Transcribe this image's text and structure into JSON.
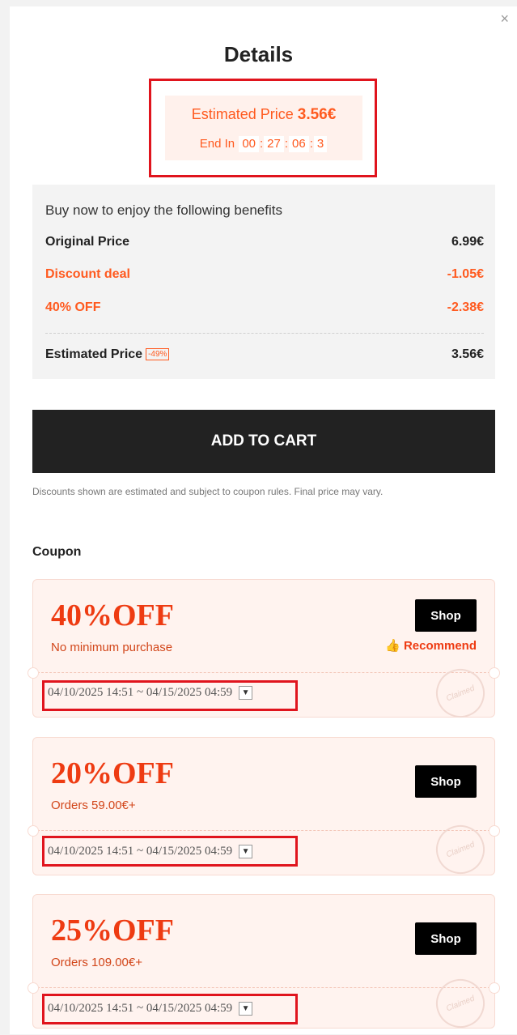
{
  "header": {
    "title": "Details",
    "close_glyph": "×"
  },
  "estimate": {
    "label": "Estimated Price",
    "price": "3.56€",
    "end_label": "End In",
    "timer": [
      "00",
      "27",
      "06",
      "3"
    ],
    "separator": ":"
  },
  "benefits": {
    "heading": "Buy now to enjoy the following benefits",
    "rows": [
      {
        "label": "Original Price",
        "value": "6.99€"
      },
      {
        "label": "Discount deal",
        "value": "-1.05€"
      },
      {
        "label": "40% OFF",
        "value": "-2.38€"
      }
    ],
    "total": {
      "label": "Estimated Price",
      "badge": "-49%",
      "value": "3.56€"
    }
  },
  "cart_button": "ADD TO CART",
  "disclaimer": "Discounts shown are estimated and subject to coupon rules. Final price may vary.",
  "coupon_heading": "Coupon",
  "coupons": [
    {
      "amount": "40%OFF",
      "condition": "No minimum purchase",
      "shop": "Shop",
      "recommend": "Recommend",
      "date": "04/10/2025 14:51 ~ 04/15/2025 04:59",
      "stamp": "Claimed"
    },
    {
      "amount": "20%OFF",
      "condition": "Orders 59.00€+",
      "shop": "Shop",
      "date": "04/10/2025 14:51 ~ 04/15/2025 04:59",
      "stamp": "Claimed"
    },
    {
      "amount": "25%OFF",
      "condition": "Orders 109.00€+",
      "shop": "Shop",
      "date": "04/10/2025 14:51 ~ 04/15/2025 04:59",
      "stamp": "Claimed"
    }
  ],
  "colors": {
    "accent": "#ff5a1f",
    "coupon_red": "#ee3b12",
    "highlight_box": "#e0141d",
    "button_dark": "#222222"
  },
  "icons": {
    "close": "close-icon",
    "thumb": "thumbs-up-icon",
    "dropdown": "chevron-down-icon"
  }
}
